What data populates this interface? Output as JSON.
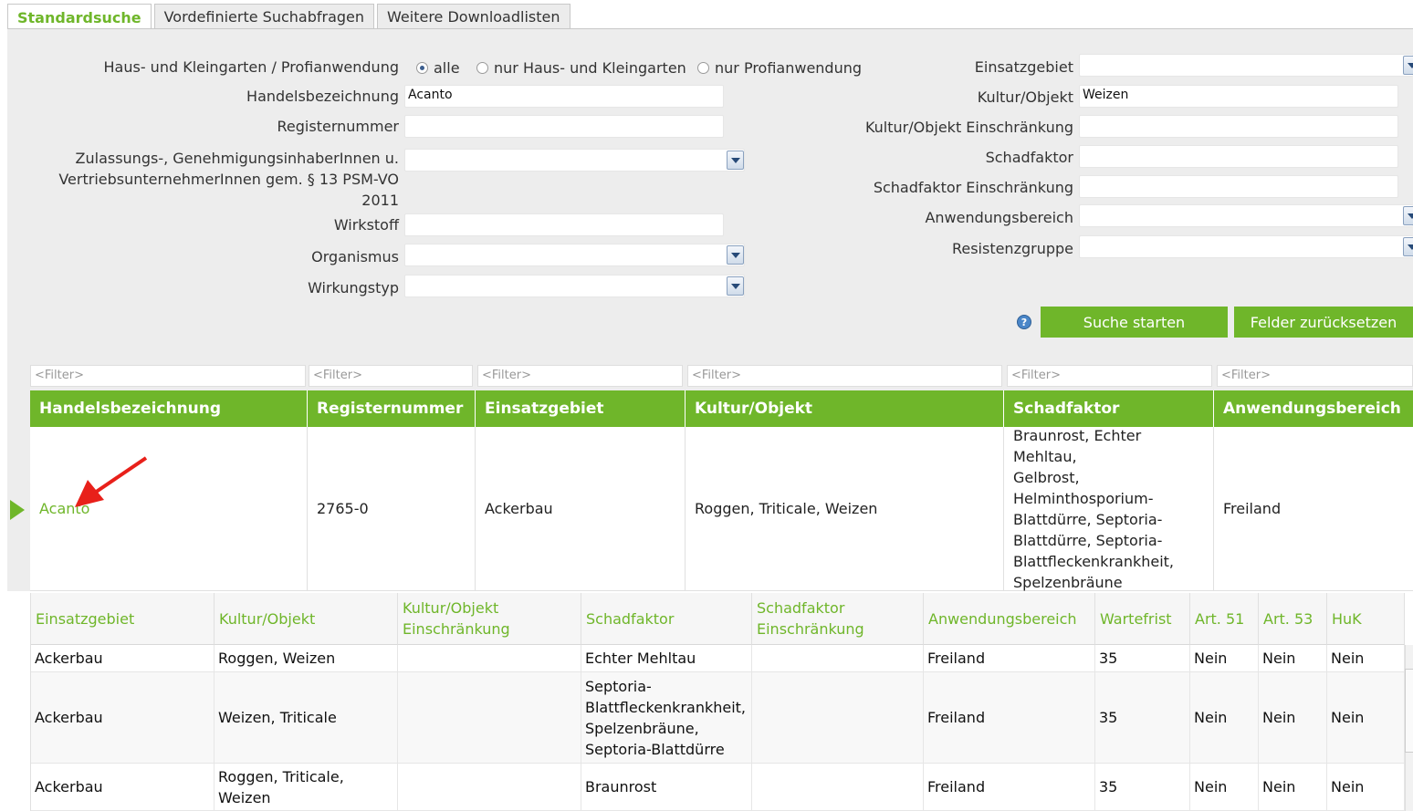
{
  "tabs": [
    "Standardsuche",
    "Vordefinierte Suchabfragen",
    "Weitere Downloadlisten"
  ],
  "form": {
    "haus_label": "Haus- und Kleingarten / Profianwendung",
    "radio_alle": "alle",
    "radio_haus": "nur Haus- und Kleingarten",
    "radio_profi": "nur Profianwendung",
    "handels_label": "Handelsbezeichnung",
    "handels_value": "Acanto",
    "register_label": "Registernummer",
    "register_value": "",
    "zulass_label_1": "Zulassungs-, GenehmigungsinhaberInnen u.",
    "zulass_label_2": "VertriebsunternehmerInnen gem. § 13 PSM-VO",
    "zulass_label_3": "2011",
    "wirkstoff_label": "Wirkstoff",
    "organismus_label": "Organismus",
    "wirkungstyp_label": "Wirkungstyp",
    "einsatz_label": "Einsatzgebiet",
    "kultur_label": "Kultur/Objekt",
    "kultur_value": "Weizen",
    "kultur_ein_label": "Kultur/Objekt Einschränkung",
    "schad_label": "Schadfaktor",
    "schad_ein_label": "Schadfaktor Einschränkung",
    "anwend_label": "Anwendungsbereich",
    "resist_label": "Resistenzgruppe",
    "help_icon": "?",
    "search_button": "Suche starten",
    "reset_button": "Felder zurücksetzen"
  },
  "grid": {
    "filter_placeholder": "<Filter>",
    "headers": [
      "Handelsbezeichnung",
      "Registernummer",
      "Einsatzgebiet",
      "Kultur/Objekt",
      "Schadfaktor",
      "Anwendungsbereich"
    ],
    "row": {
      "handels": "Acanto",
      "register": "2765-0",
      "einsatz": "Ackerbau",
      "kultur": "Roggen, Triticale, Weizen",
      "schad_lines": [
        "Braunrost, Echter Mehltau,",
        "Gelbrost,",
        "Helminthosporium-",
        "Blattdürre, Septoria-",
        "Blattdürre, Septoria-",
        "Blattfleckenkrankheit,",
        "Spelzenbräune"
      ],
      "anwend": "Freiland"
    }
  },
  "subgrid": {
    "headers": {
      "einsatz": "Einsatzgebiet",
      "kultur": "Kultur/Objekt",
      "kultur_ein_1": "Kultur/Objekt",
      "kultur_ein_2": "Einschränkung",
      "schad": "Schadfaktor",
      "schad_ein_1": "Schadfaktor",
      "schad_ein_2": "Einschränkung",
      "anwend": "Anwendungsbereich",
      "warte": "Wartefrist",
      "art51": "Art. 51",
      "art53": "Art. 53",
      "huk": "HuK"
    },
    "rows": [
      {
        "einsatz": "Ackerbau",
        "kultur_1": "Roggen, Weizen",
        "kultur_2": "",
        "schad": [
          "Echter Mehltau"
        ],
        "anwend": "Freiland",
        "warte": "35",
        "art51": "Nein",
        "art53": "Nein",
        "huk": "Nein"
      },
      {
        "einsatz": "Ackerbau",
        "kultur_1": "Weizen, Triticale",
        "kultur_2": "",
        "schad": [
          "Septoria-",
          "Blattfleckenkrankheit,",
          "Spelzenbräune,",
          "Septoria-Blattdürre"
        ],
        "anwend": "Freiland",
        "warte": "35",
        "art51": "Nein",
        "art53": "Nein",
        "huk": "Nein"
      },
      {
        "einsatz": "Ackerbau",
        "kultur_1": "Roggen, Triticale,",
        "kultur_2": "Weizen",
        "schad": [
          "Braunrost"
        ],
        "anwend": "Freiland",
        "warte": "35",
        "art51": "Nein",
        "art53": "Nein",
        "huk": "Nein"
      }
    ]
  },
  "colors": {
    "accent": "#6fb62a",
    "panel": "#ededed",
    "annotation": "#e8201a"
  }
}
